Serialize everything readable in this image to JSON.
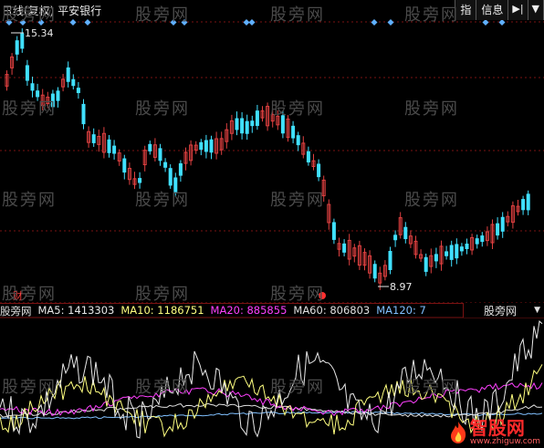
{
  "header": {
    "title": "日线(复权) 平安银行",
    "btn_index": "指",
    "btn_info": "信息",
    "icon_collapse": "back-collapse-icon",
    "icon_dropdown": "triangle-down-icon"
  },
  "price": {
    "high_label": "15.34",
    "low_label": "8.97",
    "finance_marker": "财"
  },
  "indicator": {
    "name": "股旁网",
    "ma5_label": "MA5: 1413303",
    "ma10_label": "MA10: 1186751",
    "ma20_label": "MA20: 885855",
    "ma60_label": "MA60: 806803",
    "ma120_label": "MA120: 7",
    "tag_label": "股旁网",
    "colors": {
      "ma5": "#e8e8e8",
      "ma10": "#ffff80",
      "ma20": "#ff40ff",
      "ma60": "#e0e0e0",
      "ma120": "#80c0ff"
    }
  },
  "watermark": "股旁网",
  "logo": {
    "name": "智股网",
    "url": "www.zhiguw.com",
    "icon": "flame-icon"
  },
  "colors": {
    "up": "#e04040",
    "down": "#40e0ff",
    "grid": "#7a1212",
    "bg": "#000000"
  }
}
